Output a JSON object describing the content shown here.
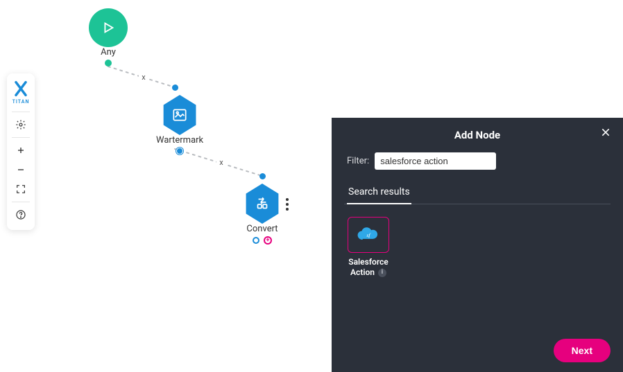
{
  "toolbar": {
    "brand": "TITAN"
  },
  "canvas": {
    "nodes": {
      "start": {
        "label": "Any"
      },
      "watermark": {
        "label": "Wartermark"
      },
      "convert": {
        "label": "Convert"
      }
    },
    "edge_remove_glyph": "x"
  },
  "panel": {
    "title": "Add Node",
    "filter_label": "Filter:",
    "filter_value": "salesforce action",
    "tabs": [
      {
        "label": "Search results"
      }
    ],
    "results": [
      {
        "label_line1": "Salesforce",
        "label_line2": "Action",
        "icon_text": "sf"
      }
    ],
    "next_label": "Next"
  },
  "colors": {
    "accent_pink": "#e6007e",
    "accent_blue": "#1a8cd8",
    "accent_green": "#1dc396",
    "panel_bg": "#2b303a"
  }
}
